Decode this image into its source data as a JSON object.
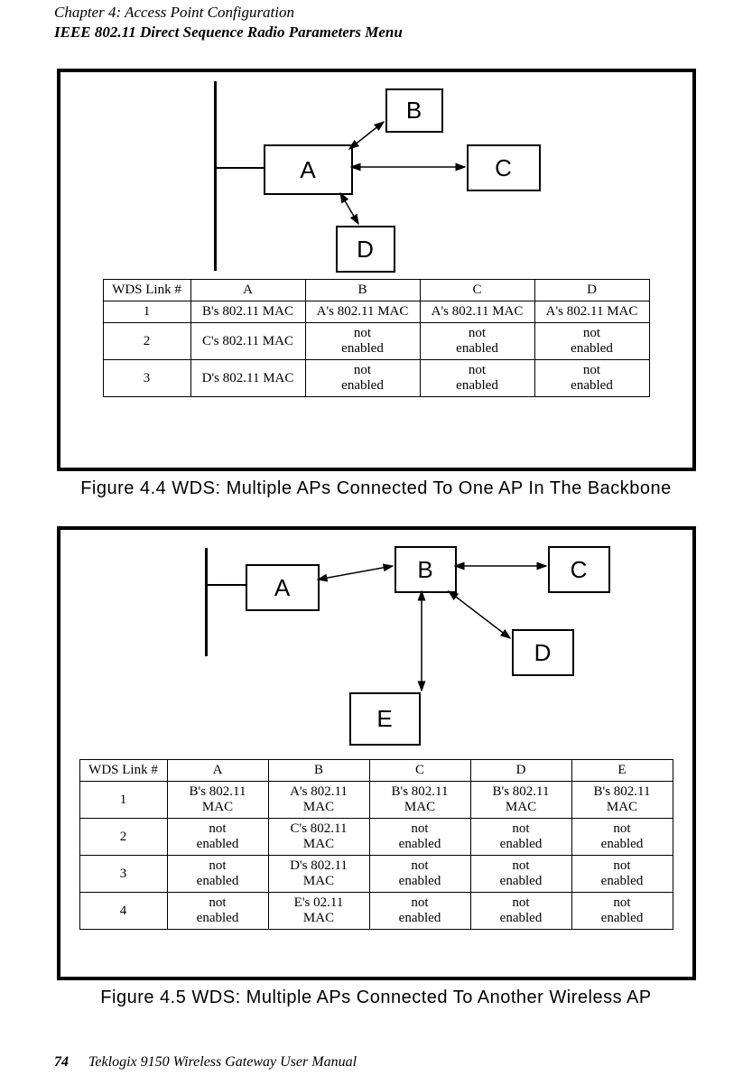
{
  "header": {
    "line1": "Chapter 4:  Access Point Configuration",
    "line2": "IEEE 802.11 Direct Sequence Radio Parameters Menu"
  },
  "footer": {
    "page_number": "74",
    "manual_title": "Teklogix 9150 Wireless Gateway User Manual"
  },
  "figure1": {
    "caption": "Figure 4.4 WDS: Multiple APs Connected To One AP In The Backbone",
    "nodes": {
      "A": "A",
      "B": "B",
      "C": "C",
      "D": "D"
    },
    "table": {
      "head": [
        "WDS Link #",
        "A",
        "B",
        "C",
        "D"
      ],
      "rows": [
        [
          "1",
          "B's 802.11 MAC",
          "A's 802.11 MAC",
          "A's 802.11 MAC",
          "A's 802.11 MAC"
        ],
        [
          "2",
          "C's 802.11 MAC",
          "not enabled",
          "not enabled",
          "not enabled"
        ],
        [
          "3",
          "D's 802.11 MAC",
          "not enabled",
          "not enabled",
          "not enabled"
        ]
      ]
    }
  },
  "figure2": {
    "caption": "Figure 4.5 WDS: Multiple APs Connected To Another Wireless AP",
    "nodes": {
      "A": "A",
      "B": "B",
      "C": "C",
      "D": "D",
      "E": "E"
    },
    "table": {
      "head": [
        "WDS Link #",
        "A",
        "B",
        "C",
        "D",
        "E"
      ],
      "rows": [
        [
          "1",
          "B's 802.11 MAC",
          "A's 802.11 MAC",
          "B's 802.11 MAC",
          "B's 802.11 MAC",
          "B's 802.11 MAC"
        ],
        [
          "2",
          "not enabled",
          "C's 802.11 MAC",
          "not enabled",
          "not enabled",
          "not enabled"
        ],
        [
          "3",
          "not enabled",
          "D's 802.11 MAC",
          "not enabled",
          "not enabled",
          "not enabled"
        ],
        [
          "4",
          "not enabled",
          "E's 02.11 MAC",
          "not enabled",
          "not enabled",
          "not enabled"
        ]
      ]
    }
  },
  "chart_data": [
    {
      "type": "table",
      "title": "WDS Links — 1 AP on backbone (A) with B,C,D wireless",
      "columns": [
        "WDS Link #",
        "A",
        "B",
        "C",
        "D"
      ],
      "rows": [
        [
          1,
          "B's 802.11 MAC",
          "A's 802.11 MAC",
          "A's 802.11 MAC",
          "A's 802.11 MAC"
        ],
        [
          2,
          "C's 802.11 MAC",
          "not enabled",
          "not enabled",
          "not enabled"
        ],
        [
          3,
          "D's 802.11 MAC",
          "not enabled",
          "not enabled",
          "not enabled"
        ]
      ],
      "diagram_edges": [
        [
          "A",
          "B"
        ],
        [
          "A",
          "C"
        ],
        [
          "A",
          "D"
        ]
      ],
      "backbone_node": "A"
    },
    {
      "type": "table",
      "title": "WDS Links — A on backbone, B wireless hub to C,D,E",
      "columns": [
        "WDS Link #",
        "A",
        "B",
        "C",
        "D",
        "E"
      ],
      "rows": [
        [
          1,
          "B's 802.11 MAC",
          "A's 802.11 MAC",
          "B's 802.11 MAC",
          "B's 802.11 MAC",
          "B's 802.11 MAC"
        ],
        [
          2,
          "not enabled",
          "C's 802.11 MAC",
          "not enabled",
          "not enabled",
          "not enabled"
        ],
        [
          3,
          "not enabled",
          "D's 802.11 MAC",
          "not enabled",
          "not enabled",
          "not enabled"
        ],
        [
          4,
          "not enabled",
          "E's 02.11 MAC",
          "not enabled",
          "not enabled",
          "not enabled"
        ]
      ],
      "diagram_edges": [
        [
          "A",
          "B"
        ],
        [
          "B",
          "C"
        ],
        [
          "B",
          "D"
        ],
        [
          "B",
          "E"
        ]
      ],
      "backbone_node": "A"
    }
  ]
}
